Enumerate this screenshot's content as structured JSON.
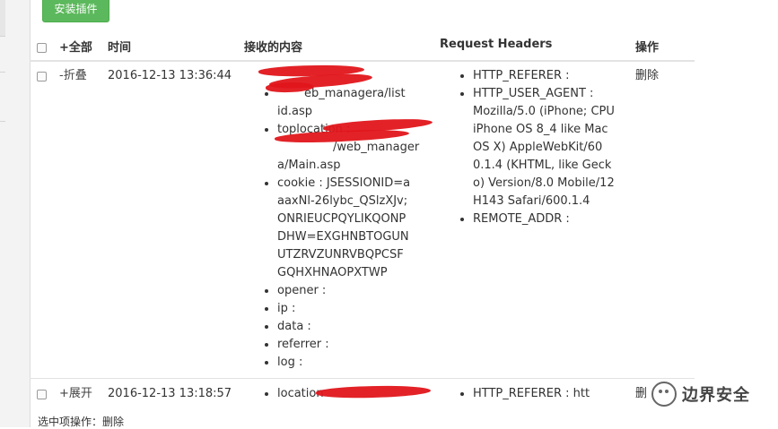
{
  "toolbar": {
    "install_label": "安装插件"
  },
  "table": {
    "headers": {
      "toggle_all": "+全部",
      "time": "时间",
      "content": "接收的内容",
      "request_headers": "Request Headers",
      "actions": "操作"
    },
    "rows": [
      {
        "toggle": "-折叠",
        "time": "2016-12-13 13:36:44",
        "content": [
          [
            "eb_managera/list",
            "id.asp"
          ],
          [
            "toplocation :",
            "/web_manager",
            "a/Main.asp"
          ],
          [
            "cookie : JSESSIONID=a",
            "aaxNl-26lybc_QSlzXJv;",
            "ONRIEUCPQYLIKQONP",
            "DHW=EXGHNBTOGUN",
            "UTZRVZUNRVBQPCSF",
            "GQHXHNAOPXTWP"
          ],
          [
            "opener :"
          ],
          [
            "ip :"
          ],
          [
            "data :"
          ],
          [
            "referrer :"
          ],
          [
            "log :"
          ]
        ],
        "headers": [
          [
            "HTTP_REFERER :"
          ],
          [
            "HTTP_USER_AGENT :",
            "Mozilla/5.0 (iPhone; CPU",
            "iPhone OS 8_4 like Mac",
            "OS X) AppleWebKit/60",
            "0.1.4 (KHTML, like Geck",
            "o) Version/8.0 Mobile/12",
            "H143 Safari/600.1.4"
          ],
          [
            "REMOTE_ADDR :"
          ]
        ],
        "action": "删除"
      },
      {
        "toggle": "+展开",
        "time": "2016-12-13 13:18:57",
        "content": [
          [
            "location"
          ]
        ],
        "headers": [
          [
            "HTTP_REFERER : htt"
          ]
        ],
        "action": "删"
      }
    ]
  },
  "footer": {
    "batch_label": "选中项操作：",
    "batch_delete": "删除"
  },
  "watermark": {
    "text": "边界安全"
  },
  "colors": {
    "install_button": "#5cb85c",
    "redaction": "#e0161b"
  }
}
